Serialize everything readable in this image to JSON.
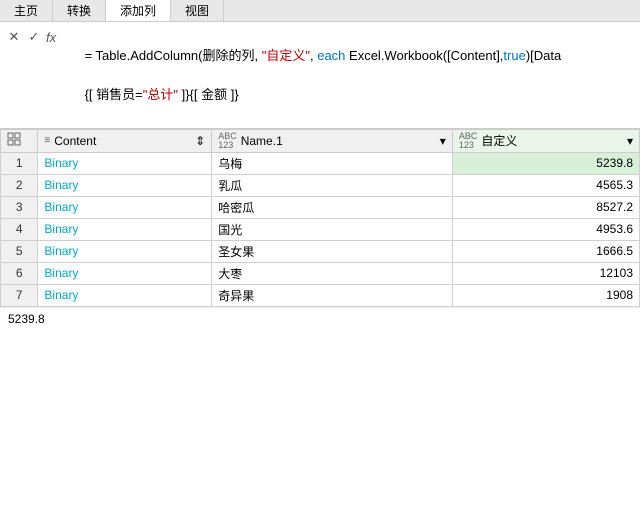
{
  "topNav": {
    "tabs": [
      {
        "label": "主页",
        "active": false
      },
      {
        "label": "转换",
        "active": false
      },
      {
        "label": "添加列",
        "active": true
      },
      {
        "label": "视图",
        "active": false
      }
    ]
  },
  "formulaBar": {
    "cancelIcon": "✕",
    "confirmIcon": "✓",
    "fxLabel": "fx",
    "formulaLine1": "= Table.AddColumn(删除的列, \"自定义\", each Excel.Workbook([Content],true)[Data",
    "formulaLine2": "{[ 销售员=\"总计\" ]}{[ 金额 ]}"
  },
  "tableHeader": {
    "selectorSymbol": "▦",
    "columns": [
      {
        "icon": "≡",
        "label": "Content",
        "sortIcon": "⇕",
        "type": "table"
      },
      {
        "icon": "ABC\n123",
        "label": "Name.1",
        "sortIcon": "▾",
        "type": "text"
      },
      {
        "icon": "ABC\n123",
        "label": "自定义",
        "sortIcon": "▾",
        "type": "text"
      }
    ]
  },
  "tableRows": [
    {
      "rowNum": 1,
      "content": "Binary",
      "name1": "乌梅",
      "custom": "5239.8"
    },
    {
      "rowNum": 2,
      "content": "Binary",
      "name1": "乳瓜",
      "custom": "4565.3"
    },
    {
      "rowNum": 3,
      "content": "Binary",
      "name1": "哈密瓜",
      "custom": "8527.2"
    },
    {
      "rowNum": 4,
      "content": "Binary",
      "name1": "国光",
      "custom": "4953.6"
    },
    {
      "rowNum": 5,
      "content": "Binary",
      "name1": "圣女果",
      "custom": "1666.5"
    },
    {
      "rowNum": 6,
      "content": "Binary",
      "name1": "大枣",
      "custom": "12103"
    },
    {
      "rowNum": 7,
      "content": "Binary",
      "name1": "奇异果",
      "custom": "1908"
    }
  ],
  "statusBar": {
    "value": "5239.8"
  }
}
